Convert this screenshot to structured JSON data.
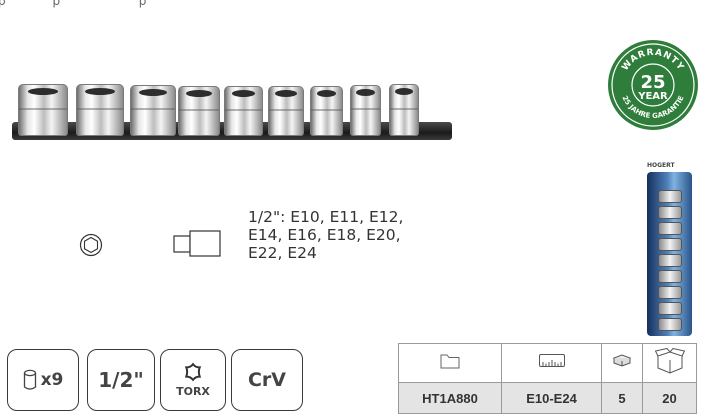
{
  "icons": {
    "hex_socket": "hex-socket-icon",
    "square_drive": "square-drive-icon",
    "socket_count": "socket-icon",
    "torx": "torx-icon",
    "folder": "folder-icon",
    "ruler": "ruler-icon",
    "box": "box-icon",
    "carton": "carton-icon"
  },
  "warranty_badge": {
    "top_text": "WARRANTY",
    "years": "25",
    "unit": "YEAR",
    "bottom_text": "25 JAHRE GARANTIE",
    "color": "#2e7d3a"
  },
  "package": {
    "brand": "HOGERT"
  },
  "spec": {
    "lines": [
      "1/2\": E10, E11, E12,",
      "E14, E16, E18, E20,",
      "E22, E24"
    ]
  },
  "features": {
    "quantity": "x9",
    "drive_size": "1/2\"",
    "profile": "TORX",
    "material": "CrV"
  },
  "product_table": {
    "values": {
      "code": "HT1A880",
      "range": "E10-E24",
      "pack_qty": "5",
      "carton_qty": "20"
    }
  }
}
